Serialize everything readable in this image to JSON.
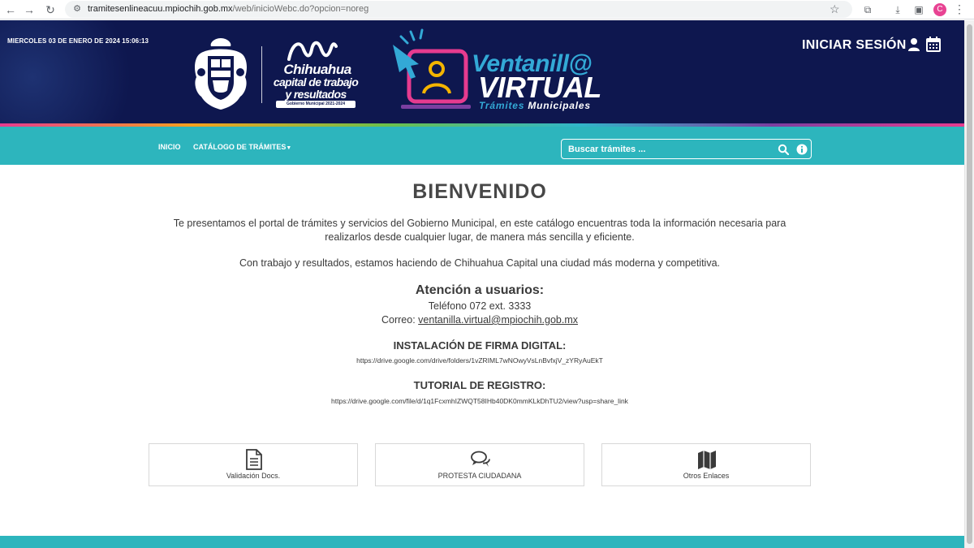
{
  "browser": {
    "url_host": "tramitesenlineacuu.mpiochih.gob.mx",
    "url_path": "/web/inicioWebc.do?opcion=noreg",
    "profile_initial": "C"
  },
  "header": {
    "datetime": "MIERCOLES 03 DE ENERO DE 2024 15:06:13",
    "municipality_logo": {
      "line1": "Chihuahua",
      "line2": "capital de trabajo",
      "line3": "y resultados",
      "tagline": "Gobierno Municipal 2021-2024"
    },
    "portal_logo": {
      "title1": "Ventanill@",
      "title2": "VIRTUAL",
      "subtitle_word1": "Trámites",
      "subtitle_word2": "Municipales"
    },
    "login_label": "INICIAR SESIÓN"
  },
  "nav": {
    "inicio": "INICIO",
    "catalogo": "CATÁLOGO DE TRÁMITES",
    "search_placeholder": "Buscar trámites ..."
  },
  "main": {
    "title": "BIENVENIDO",
    "intro_line1": "Te presentamos el portal de trámites y servicios del Gobierno Municipal, en este catálogo encuentras toda la información necesaria para",
    "intro_line2": "realizarlos desde cualquier lugar, de manera más sencilla y eficiente.",
    "intro_p2": "Con trabajo y resultados, estamos haciendo de Chihuahua Capital una ciudad más moderna y competitiva.",
    "attention_title": "Atención a usuarios:",
    "phone": "Teléfono 072 ext. 3333",
    "email_prefix": "Correo:",
    "email": "ventanilla.virtual@mpiochih.gob.mx",
    "firma_title": "INSTALACIÓN DE FIRMA DIGITAL:",
    "firma_link": "https://drive.google.com/drive/folders/1vZRIML7wNOwyVsLnBvfxjV_zYRyAuEkT",
    "tutorial_title": "TUTORIAL DE REGISTRO:",
    "tutorial_link": "https://drive.google.com/file/d/1q1FcxmhIZWQT58IHb40DK0mmKLkDhTU2/view?usp=share_link"
  },
  "cards": [
    {
      "label": "Validación Docs.",
      "icon": "document-icon"
    },
    {
      "label": "PROTESTA CIUDADANA",
      "icon": "comments-icon"
    },
    {
      "label": "Otros Enlaces",
      "icon": "map-icon"
    }
  ],
  "colors": {
    "header_bg": "#0e174f",
    "nav_bg": "#2db5bd",
    "accent_blue": "#33a9d6",
    "accent_pink": "#e63b8f"
  }
}
